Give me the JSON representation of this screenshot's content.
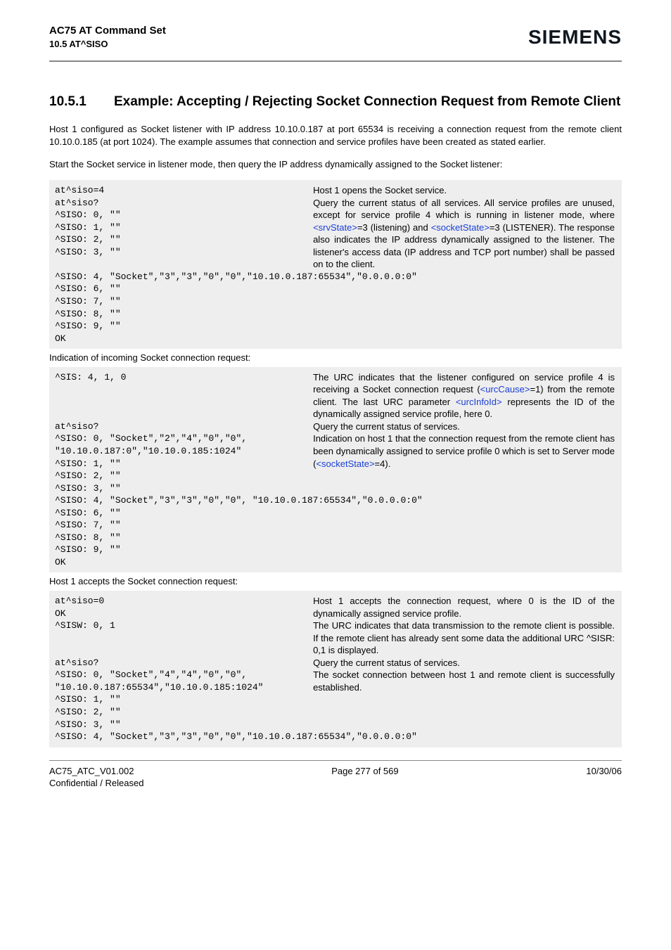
{
  "header": {
    "doc_title": "AC75 AT Command Set",
    "section_ref": "10.5 AT^SISO",
    "brand": "SIEMENS"
  },
  "heading": {
    "number": "10.5.1",
    "title": "Example: Accepting / Rejecting Socket Connection Request from Remote Client"
  },
  "para1": "Host 1 configured as Socket listener with IP address 10.10.0.187 at port 65534 is receiving a connection request from the remote client 10.10.0.185 (at port 1024). The example assumes that connection and service profiles have been created as stated earlier.",
  "para2": "Start the Socket service in listener mode, then query the IP address dynamically assigned to the Socket listener:",
  "block1": {
    "l1": "at^siso=4",
    "r1": "Host 1 opens the Socket service.",
    "l2": "at^siso?\n^SISO: 0, \"\"\n^SISO: 1, \"\"\n^SISO: 2, \"\"\n^SISO: 3, \"\"",
    "r2a": "Query the current status of all services. All service profiles are unused, except for service profile 4 which is running in listener mode, where ",
    "r2_link1": "<srvState>",
    "r2b": "=3 (listening) and ",
    "r2_link2": "<socketState>",
    "r2c": "=3 (LISTENER). The response also indicates the IP address dynamically assigned to the listener. The listener's access data (IP address and TCP port number) shall be passed on to the client.",
    "tail": "^SISO: 4, \"Socket\",\"3\",\"3\",\"0\",\"0\",\"10.10.0.187:65534\",\"0.0.0.0:0\"\n^SISO: 6, \"\"\n^SISO: 7, \"\"\n^SISO: 8, \"\"\n^SISO: 9, \"\"\nOK"
  },
  "narr1": "Indication of incoming Socket connection request:",
  "block2": {
    "l1": "^SIS: 4, 1, 0",
    "r1a": "The URC indicates that the listener configured on service profile 4 is receiving a Socket connection request (",
    "r1_link1": "<urcCause>",
    "r1b": "=1) from the remote client. The last URC parameter ",
    "r1_link2": "<urcInfoId>",
    "r1c": " represents the ID of the dynamically assigned service profile, here 0.",
    "l2": "at^siso?",
    "r2": "Query the current status of services.",
    "l3": "^SISO: 0, \"Socket\",\"2\",\"4\",\"0\",\"0\",\n\"10.10.0.187:0\",\"10.10.0.185:1024\"\n^SISO: 1, \"\"\n^SISO: 2, \"\"",
    "r3a": "Indication on host 1 that the connection request from the remote client has been dynamically assigned to service profile 0 which is set to Server mode (",
    "r3_link1": "<socketState>",
    "r3b": "=4).",
    "tail": "^SISO: 3, \"\"\n^SISO: 4, \"Socket\",\"3\",\"3\",\"0\",\"0\", \"10.10.0.187:65534\",\"0.0.0.0:0\"\n^SISO: 6, \"\"\n^SISO: 7, \"\"\n^SISO: 8, \"\"\n^SISO: 9, \"\"\nOK"
  },
  "narr2": "Host 1 accepts the Socket connection request:",
  "block3": {
    "l1": "at^siso=0\nOK",
    "r1": "Host 1 accepts the connection request, where 0 is the ID of the dynamically assigned service profile.",
    "l2": "^SISW: 0, 1",
    "r2": "The URC indicates that data transmission to the remote client is possible. If the remote client has already sent some data the additional URC ^SISR: 0,1 is displayed.",
    "l3": "at^siso?",
    "r3": "Query the current status of services.",
    "l4": "^SISO: 0, \"Socket\",\"4\",\"4\",\"0\",\"0\",\n\"10.10.0.187:65534\",\"10.10.0.185:1024\"",
    "r4": "The socket connection between host 1 and remote client is successfully established.",
    "tail": "^SISO: 1, \"\"\n^SISO: 2, \"\"\n^SISO: 3, \"\"\n^SISO: 4, \"Socket\",\"3\",\"3\",\"0\",\"0\",\"10.10.0.187:65534\",\"0.0.0.0:0\""
  },
  "footer": {
    "left1": "AC75_ATC_V01.002",
    "left2": "Confidential / Released",
    "center": "Page 277 of 569",
    "right": "10/30/06"
  }
}
